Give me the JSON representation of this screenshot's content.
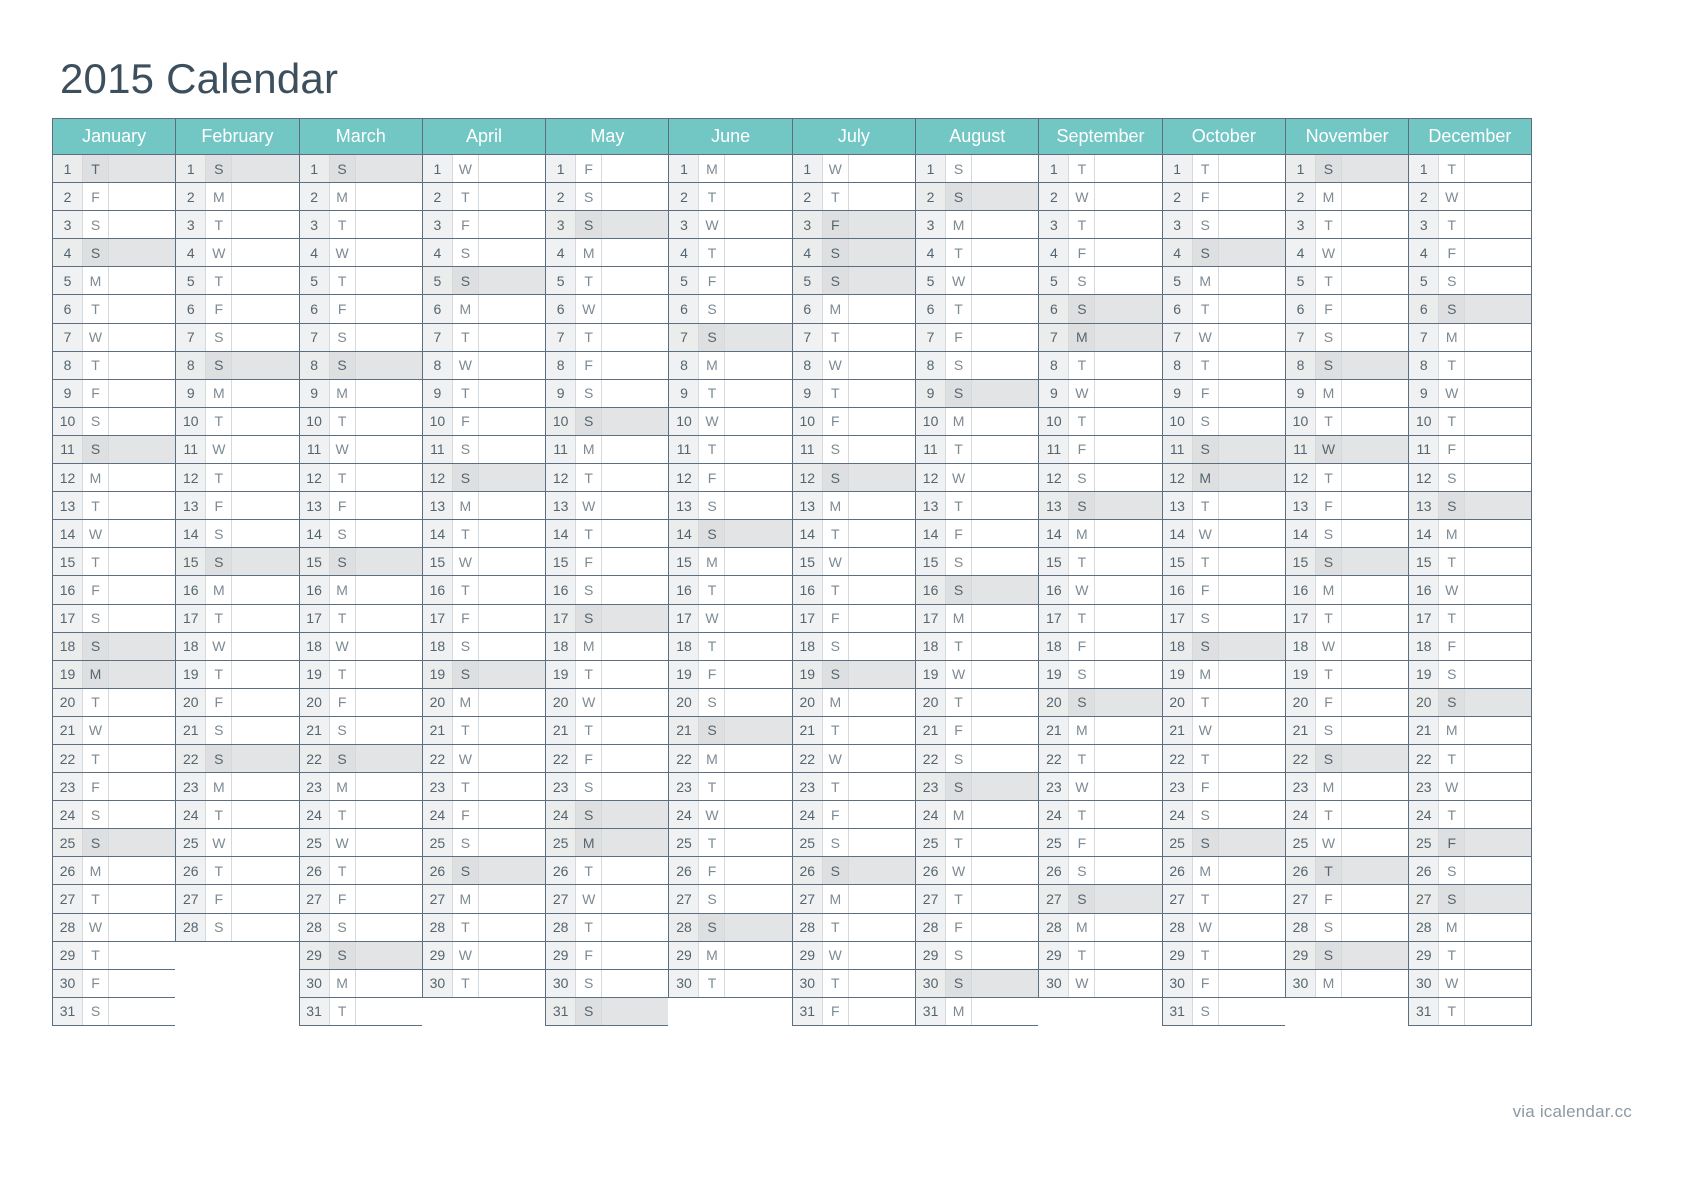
{
  "title": "2015 Calendar",
  "footer": {
    "credit": "via icalendar.cc"
  },
  "colors": {
    "header_teal": "#72c6c4",
    "header_text": "#ffffff",
    "title_text": "#3d4f5d",
    "grid_border": "#5c6e80",
    "daynum_bg": "#f0f1f2",
    "highlight_bg": "#e3e4e5",
    "footer_text": "#8d9aa3"
  },
  "calendar": {
    "year": 2015,
    "weekday_letters": {
      "Sun": "S",
      "Mon": "M",
      "Tue": "T",
      "Wed": "W",
      "Thu": "T",
      "Fri": "F",
      "Sat": "S"
    },
    "max_rows": 31,
    "months": [
      {
        "name": "January",
        "index": 1,
        "days": 31,
        "start_weekday": "Thu",
        "highlighted_days": [
          1,
          4,
          11,
          18,
          19,
          25
        ],
        "weekdays": [
          "T",
          "F",
          "S",
          "S",
          "M",
          "T",
          "W",
          "T",
          "F",
          "S",
          "S",
          "M",
          "T",
          "W",
          "T",
          "F",
          "S",
          "S",
          "M",
          "T",
          "W",
          "T",
          "F",
          "S",
          "S",
          "M",
          "T",
          "W",
          "T",
          "F",
          "S"
        ]
      },
      {
        "name": "February",
        "index": 2,
        "days": 28,
        "start_weekday": "Sun",
        "highlighted_days": [
          1,
          8,
          15,
          22
        ],
        "weekdays": [
          "S",
          "M",
          "T",
          "W",
          "T",
          "F",
          "S",
          "S",
          "M",
          "T",
          "W",
          "T",
          "F",
          "S",
          "S",
          "M",
          "T",
          "W",
          "T",
          "F",
          "S",
          "S",
          "M",
          "T",
          "W",
          "T",
          "F",
          "S"
        ]
      },
      {
        "name": "March",
        "index": 3,
        "days": 31,
        "start_weekday": "Sun",
        "highlighted_days": [
          1,
          8,
          15,
          22,
          29
        ],
        "weekdays": [
          "S",
          "M",
          "T",
          "W",
          "T",
          "F",
          "S",
          "S",
          "M",
          "T",
          "W",
          "T",
          "F",
          "S",
          "S",
          "M",
          "T",
          "W",
          "T",
          "F",
          "S",
          "S",
          "M",
          "T",
          "W",
          "T",
          "F",
          "S",
          "S",
          "M",
          "T"
        ]
      },
      {
        "name": "April",
        "index": 4,
        "days": 30,
        "start_weekday": "Wed",
        "highlighted_days": [
          5,
          12,
          19,
          26
        ],
        "weekdays": [
          "W",
          "T",
          "F",
          "S",
          "S",
          "M",
          "T",
          "W",
          "T",
          "F",
          "S",
          "S",
          "M",
          "T",
          "W",
          "T",
          "F",
          "S",
          "S",
          "M",
          "T",
          "W",
          "T",
          "F",
          "S",
          "S",
          "M",
          "T",
          "W",
          "T"
        ]
      },
      {
        "name": "May",
        "index": 5,
        "days": 31,
        "start_weekday": "Fri",
        "highlighted_days": [
          3,
          10,
          17,
          24,
          25,
          31
        ],
        "weekdays": [
          "F",
          "S",
          "S",
          "M",
          "T",
          "W",
          "T",
          "F",
          "S",
          "S",
          "M",
          "T",
          "W",
          "T",
          "F",
          "S",
          "S",
          "M",
          "T",
          "W",
          "T",
          "F",
          "S",
          "S",
          "M",
          "T",
          "W",
          "T",
          "F",
          "S",
          "S"
        ]
      },
      {
        "name": "June",
        "index": 6,
        "days": 30,
        "start_weekday": "Mon",
        "highlighted_days": [
          7,
          14,
          21,
          28
        ],
        "weekdays": [
          "M",
          "T",
          "W",
          "T",
          "F",
          "S",
          "S",
          "M",
          "T",
          "W",
          "T",
          "F",
          "S",
          "S",
          "M",
          "T",
          "W",
          "T",
          "F",
          "S",
          "S",
          "M",
          "T",
          "W",
          "T",
          "F",
          "S",
          "S",
          "M",
          "T"
        ]
      },
      {
        "name": "July",
        "index": 7,
        "days": 31,
        "start_weekday": "Wed",
        "highlighted_days": [
          3,
          4,
          5,
          12,
          19,
          26
        ],
        "weekdays": [
          "W",
          "T",
          "F",
          "S",
          "S",
          "M",
          "T",
          "W",
          "T",
          "F",
          "S",
          "S",
          "M",
          "T",
          "W",
          "T",
          "F",
          "S",
          "S",
          "M",
          "T",
          "W",
          "T",
          "F",
          "S",
          "S",
          "M",
          "T",
          "W",
          "T",
          "F"
        ]
      },
      {
        "name": "August",
        "index": 8,
        "days": 31,
        "start_weekday": "Sat",
        "highlighted_days": [
          2,
          9,
          16,
          23,
          30
        ],
        "weekdays": [
          "S",
          "S",
          "M",
          "T",
          "W",
          "T",
          "F",
          "S",
          "S",
          "M",
          "T",
          "W",
          "T",
          "F",
          "S",
          "S",
          "M",
          "T",
          "W",
          "T",
          "F",
          "S",
          "S",
          "M",
          "T",
          "W",
          "T",
          "F",
          "S",
          "S",
          "M"
        ]
      },
      {
        "name": "September",
        "index": 9,
        "days": 30,
        "start_weekday": "Tue",
        "highlighted_days": [
          6,
          7,
          13,
          20,
          27
        ],
        "weekdays": [
          "T",
          "W",
          "T",
          "F",
          "S",
          "S",
          "M",
          "T",
          "W",
          "T",
          "F",
          "S",
          "S",
          "M",
          "T",
          "W",
          "T",
          "F",
          "S",
          "S",
          "M",
          "T",
          "W",
          "T",
          "F",
          "S",
          "S",
          "M",
          "T",
          "W"
        ]
      },
      {
        "name": "October",
        "index": 10,
        "days": 31,
        "start_weekday": "Thu",
        "highlighted_days": [
          4,
          11,
          12,
          18,
          25
        ],
        "weekdays": [
          "T",
          "F",
          "S",
          "S",
          "M",
          "T",
          "W",
          "T",
          "F",
          "S",
          "S",
          "M",
          "T",
          "W",
          "T",
          "F",
          "S",
          "S",
          "M",
          "T",
          "W",
          "T",
          "F",
          "S",
          "S",
          "M",
          "T",
          "W",
          "T",
          "F",
          "S"
        ]
      },
      {
        "name": "November",
        "index": 11,
        "days": 30,
        "start_weekday": "Sun",
        "highlighted_days": [
          1,
          8,
          11,
          15,
          22,
          26,
          29
        ],
        "weekdays": [
          "S",
          "M",
          "T",
          "W",
          "T",
          "F",
          "S",
          "S",
          "M",
          "T",
          "W",
          "T",
          "F",
          "S",
          "S",
          "M",
          "T",
          "W",
          "T",
          "F",
          "S",
          "S",
          "M",
          "T",
          "W",
          "T",
          "F",
          "S",
          "S",
          "M"
        ]
      },
      {
        "name": "December",
        "index": 12,
        "days": 31,
        "start_weekday": "Tue",
        "highlighted_days": [
          6,
          13,
          20,
          25,
          27
        ],
        "weekdays": [
          "T",
          "W",
          "T",
          "F",
          "S",
          "S",
          "M",
          "T",
          "W",
          "T",
          "F",
          "S",
          "S",
          "M",
          "T",
          "W",
          "T",
          "F",
          "S",
          "S",
          "M",
          "T",
          "W",
          "T",
          "F",
          "S",
          "S",
          "M",
          "T",
          "W",
          "T"
        ]
      }
    ]
  }
}
